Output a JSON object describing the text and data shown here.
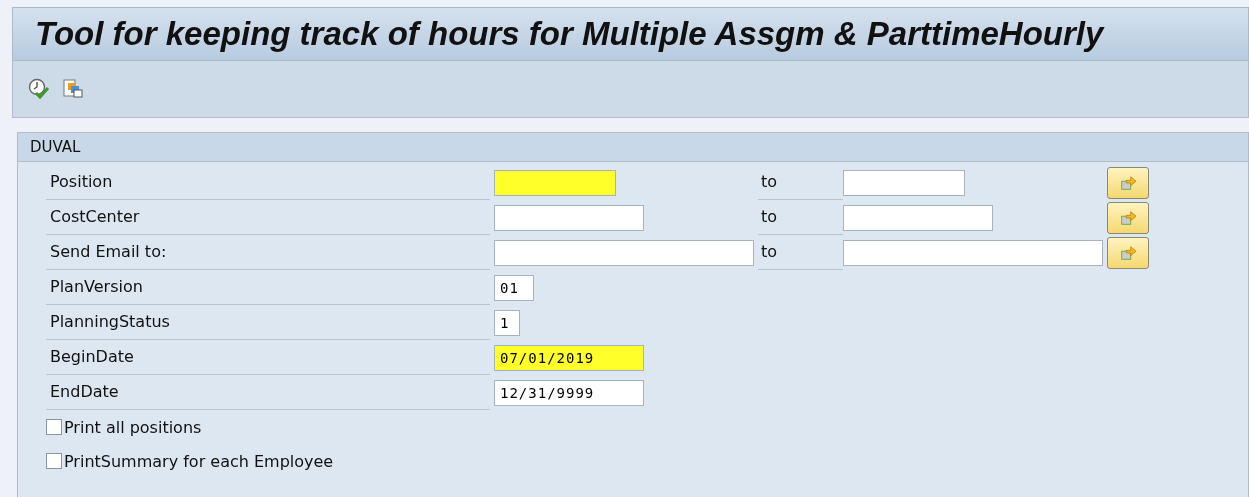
{
  "window": {
    "title": "Tool  for keeping track of hours for Multiple Assgm & ParttimeHourly"
  },
  "toolbar": [
    {
      "kind": "execute"
    },
    {
      "kind": "variants"
    }
  ],
  "group": {
    "title": "DUVAL",
    "rows": [
      {
        "kind": "range",
        "label": "Position",
        "highlighted": true,
        "to_label": "to"
      },
      {
        "kind": "range",
        "label": "CostCenter",
        "highlighted": false,
        "to_label": "to"
      },
      {
        "kind": "range",
        "label": "Send Email to:",
        "highlighted": false,
        "to_label": "to"
      },
      {
        "kind": "single",
        "label": "PlanVersion",
        "value": "01",
        "highlighted": false
      },
      {
        "kind": "single",
        "label": "PlanningStatus",
        "value": "1",
        "highlighted": false
      },
      {
        "kind": "single",
        "label": "BeginDate",
        "value": "07/01/2019",
        "highlighted": true
      },
      {
        "kind": "single",
        "label": "EndDate",
        "value": "12/31/9999",
        "highlighted": false
      },
      {
        "kind": "checkbox",
        "label": "Print all positions",
        "checked": false
      },
      {
        "kind": "checkbox",
        "label": "PrintSummary for each Employee",
        "checked": false
      }
    ]
  }
}
